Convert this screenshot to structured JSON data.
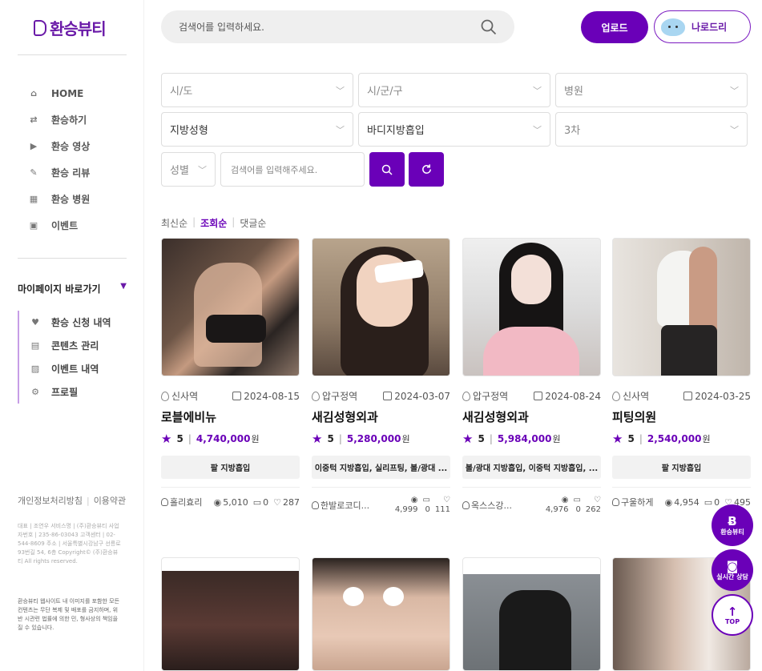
{
  "brand": {
    "name": "환승뷰티",
    "accent": "#6a00b8"
  },
  "nav": [
    {
      "icon": "home-icon",
      "glyph": "⌂",
      "label": "HOME"
    },
    {
      "icon": "exchange-icon",
      "glyph": "⇄",
      "label": "환승하기"
    },
    {
      "icon": "video-icon",
      "glyph": "▶",
      "label": "환승 영상"
    },
    {
      "icon": "pen-icon",
      "glyph": "✎",
      "label": "환승 리뷰"
    },
    {
      "icon": "hospital-icon",
      "glyph": "▦",
      "label": "환승 병원"
    },
    {
      "icon": "gift-icon",
      "glyph": "▣",
      "label": "이벤트"
    }
  ],
  "mypage": {
    "title": "마이페이지 바로가기",
    "items": [
      {
        "icon": "heart-icon",
        "glyph": "♥",
        "label": "환승 신청 내역"
      },
      {
        "icon": "document-icon",
        "glyph": "▤",
        "label": "콘텐츠 관리"
      },
      {
        "icon": "image-icon",
        "glyph": "▨",
        "label": "이벤트 내역"
      },
      {
        "icon": "gear-icon",
        "glyph": "⚙",
        "label": "프로필"
      }
    ]
  },
  "footer": {
    "privacy": "개인정보처리방침",
    "terms": "이용약관",
    "info": "대표 | 조연우 서비스명 | (주)환승뷰티 사업자번호 | 235-86-03043 고객센터 | 02-544-8609 주소 | 서울특별시강남구 선릉로 93번길 54, 6층 Copyright© (주)환승뷰티 All rights reserved.",
    "note": "환승뷰티 웹사이트 내 이미지를 포함한 모든 컨텐츠는 무단 복제 및 배포를 금지하며, 위반 시관련 법률에 의한 민, 형사상의 책임을 질 수 있습니다."
  },
  "search": {
    "placeholder": "검색어를 입력하세요."
  },
  "header": {
    "upload": "업로드",
    "user": "나로드리"
  },
  "filters": {
    "sido": "시/도",
    "sigungu": "시/군/구",
    "hospital": "병원",
    "cat1": "지방성형",
    "cat2": "바디지방흡입",
    "cat3": "3차",
    "gender": "성별",
    "keyword_placeholder": "검색어를 입력해주세요."
  },
  "sort": {
    "options": [
      "최신순",
      "조회순",
      "댓글순"
    ],
    "active": "조회순"
  },
  "cards": [
    {
      "loc": "신사역",
      "date": "2024-08-15",
      "hospital": "로블에비뉴",
      "rating": "5",
      "price": "4,740,000",
      "won": "원",
      "tag": "팔 지방흡입",
      "user": "홀리효리",
      "views": "5,010",
      "comments": "0",
      "likes": "287"
    },
    {
      "loc": "압구정역",
      "date": "2024-03-07",
      "hospital": "새김성형외과",
      "rating": "5",
      "price": "5,280,000",
      "won": "원",
      "tag": "이중턱 지방흡입, 실리프팅, 볼/광대 ...",
      "user": "한발로코디...",
      "views": "4,999",
      "comments": "0",
      "likes": "111"
    },
    {
      "loc": "압구정역",
      "date": "2024-08-24",
      "hospital": "새김성형외과",
      "rating": "5",
      "price": "5,984,000",
      "won": "원",
      "tag": "볼/광대 지방흡입, 이중턱 지방흡입, ...",
      "user": "옥스스강...",
      "views": "4,976",
      "comments": "0",
      "likes": "262"
    },
    {
      "loc": "신사역",
      "date": "2024-03-25",
      "hospital": "피팅의원",
      "rating": "5",
      "price": "2,540,000",
      "won": "원",
      "tag": "팔 지방흡입",
      "user": "구울하게",
      "views": "4,954",
      "comments": "0",
      "likes": "495"
    }
  ],
  "floats": {
    "brand": "환승뷰티",
    "chat": "실시간 상담",
    "top": "TOP"
  }
}
